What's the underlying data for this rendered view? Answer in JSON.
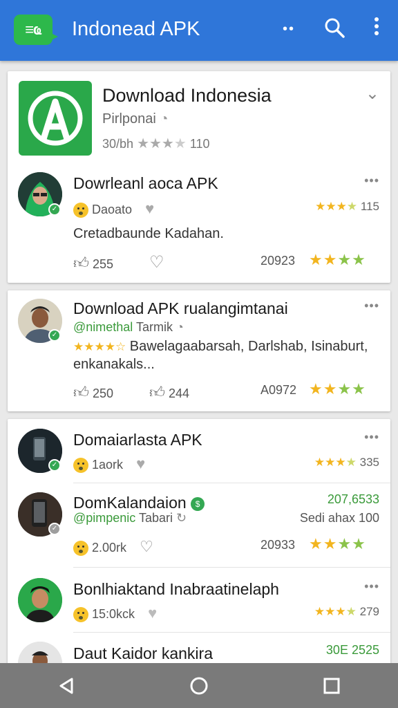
{
  "appbar": {
    "title": "Indonead APK",
    "logo_text": "≡ҩ",
    "icons": [
      "more-horizontal-icon",
      "search-icon",
      "more-vert-icon"
    ]
  },
  "header_card": {
    "title": "Download Indonesia",
    "subtitle": "Pirlponai",
    "rating_text": "30/bh",
    "star_count": "110"
  },
  "post1": {
    "title": "Dowrleanl aoca APK",
    "user": "Daoato",
    "rating_count": "115",
    "body": "Cretadbaunde Kadahan.",
    "likes": "255",
    "date": "20923"
  },
  "post2": {
    "title": "Download APK rualangimtanai",
    "handle": "@nimethal",
    "handle_sub": "Tarmik",
    "body_line1": "Bawelagaabarsah, Darlshab, Isinaburt,",
    "body_line2": "enkanakals...",
    "likes": "250",
    "comments": "244",
    "date": "A0972"
  },
  "list": [
    {
      "title": "Domaiarlasta APK",
      "meta": "1aork",
      "count": "335"
    },
    {
      "title": "DomKalandaion",
      "handle": "@pimpenic",
      "handle_sub": "Tabari",
      "top_right": "207,6533",
      "right_label": "Sedi ahax 100",
      "meta": "2.00rk",
      "date": "20933"
    },
    {
      "title": "Bonlhiaktand Inabraatinelaph",
      "meta": "15:0kck",
      "count": "279"
    },
    {
      "title": "Daut Kaidor kankira",
      "top_right": "30E 2525"
    }
  ],
  "navbar": {
    "icons": [
      "back-icon",
      "home-icon",
      "recents-icon"
    ]
  }
}
